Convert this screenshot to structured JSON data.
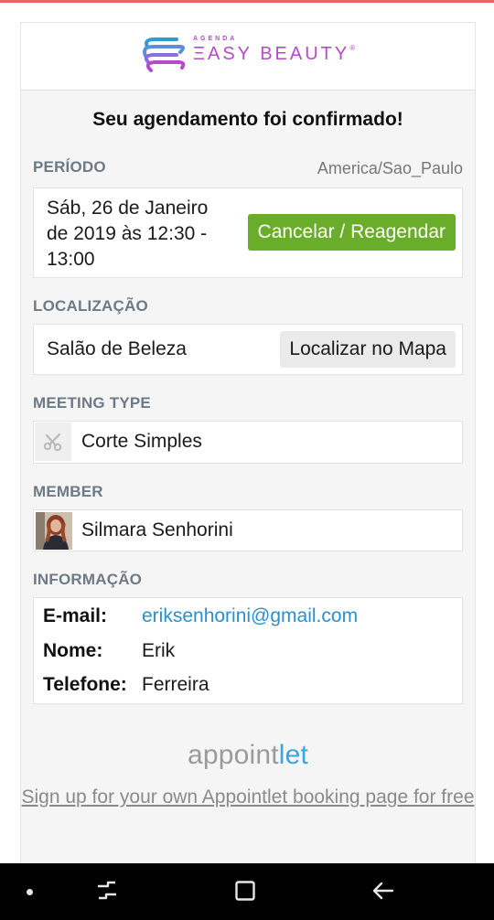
{
  "logo": {
    "agenda": "AGENDA",
    "name": "ΞASY BEAUTY",
    "registered": "®",
    "colors": {
      "primary": "#b44bc8",
      "accent": "#2e9bd8"
    }
  },
  "confirmation": {
    "title": "Seu agendamento foi confirmado!"
  },
  "period": {
    "label": "PERÍODO",
    "timezone": "America/Sao_Paulo",
    "datetime": "Sáb, 26 de Janeiro de 2019 às 12:30 - 13:00",
    "action_label": "Cancelar / Reagendar",
    "action_color": "#6aad2a"
  },
  "location": {
    "label": "LOCALIZAÇÃO",
    "place": "Salão de Beleza",
    "action_label": "Localizar no Mapa"
  },
  "meeting_type": {
    "label": "MEETING TYPE",
    "icon": "scissors-icon",
    "value": "Corte Simples"
  },
  "member": {
    "label": "MEMBER",
    "name": "Silmara Senhorini"
  },
  "information": {
    "label": "INFORMAÇÃO",
    "rows": [
      {
        "key": "E-mail:",
        "value": "eriksenhorini@gmail.com"
      },
      {
        "key": "Nome:",
        "value": "Erik"
      },
      {
        "key": "Telefone:",
        "value": "Ferreira"
      }
    ]
  },
  "footer": {
    "brand_part1": "appoint",
    "brand_part2": "let",
    "signup_text": "Sign up for your own Appointlet booking page for free"
  },
  "navbar": {
    "icons": [
      "dot-icon",
      "recent-apps-icon",
      "home-icon",
      "back-icon"
    ]
  }
}
